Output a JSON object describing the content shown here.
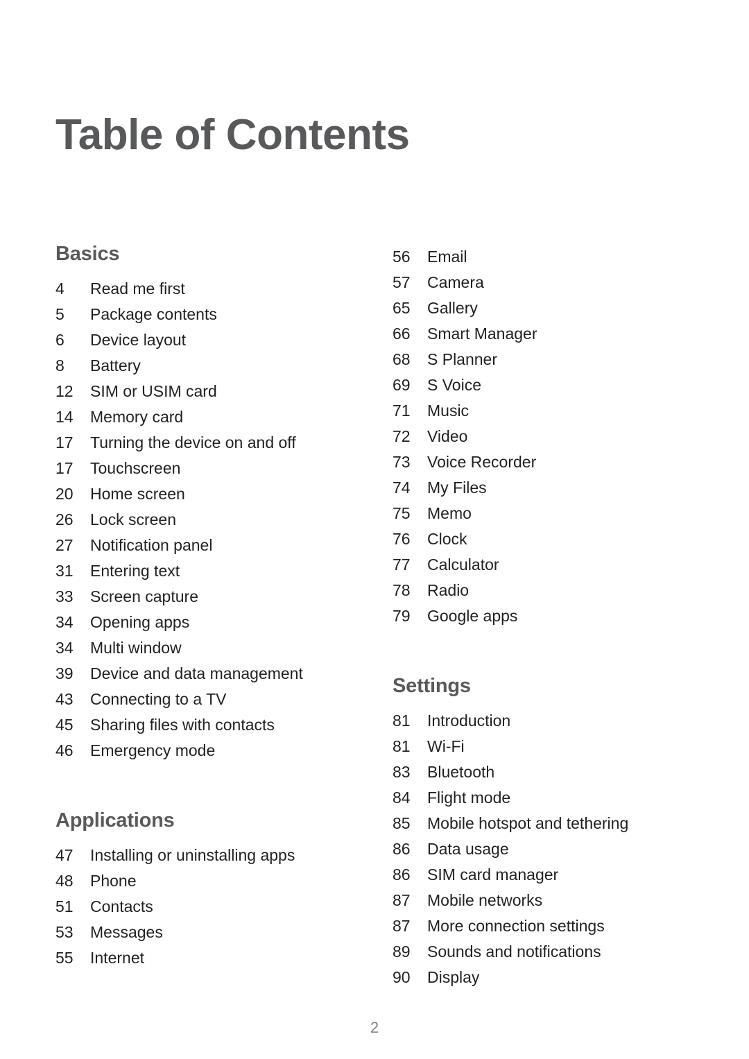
{
  "document": {
    "title": "Table of Contents",
    "page_number": "2",
    "colors": {
      "heading": "#58595b",
      "body_text": "#231f20",
      "page_number": "#808285",
      "background": "#ffffff"
    }
  },
  "columns": [
    {
      "name": "left-column",
      "sections": [
        {
          "heading": "Basics",
          "entries": [
            {
              "page": "4",
              "label": "Read me first"
            },
            {
              "page": "5",
              "label": "Package contents"
            },
            {
              "page": "6",
              "label": "Device layout"
            },
            {
              "page": "8",
              "label": "Battery"
            },
            {
              "page": "12",
              "label": "SIM or USIM card"
            },
            {
              "page": "14",
              "label": "Memory card"
            },
            {
              "page": "17",
              "label": "Turning the device on and off"
            },
            {
              "page": "17",
              "label": "Touchscreen"
            },
            {
              "page": "20",
              "label": "Home screen"
            },
            {
              "page": "26",
              "label": "Lock screen"
            },
            {
              "page": "27",
              "label": "Notification panel"
            },
            {
              "page": "31",
              "label": "Entering text"
            },
            {
              "page": "33",
              "label": "Screen capture"
            },
            {
              "page": "34",
              "label": "Opening apps"
            },
            {
              "page": "34",
              "label": "Multi window"
            },
            {
              "page": "39",
              "label": "Device and data management"
            },
            {
              "page": "43",
              "label": "Connecting to a TV"
            },
            {
              "page": "45",
              "label": "Sharing files with contacts"
            },
            {
              "page": "46",
              "label": "Emergency mode"
            }
          ]
        },
        {
          "heading": "Applications",
          "entries": [
            {
              "page": "47",
              "label": "Installing or uninstalling apps"
            },
            {
              "page": "48",
              "label": "Phone"
            },
            {
              "page": "51",
              "label": "Contacts"
            },
            {
              "page": "53",
              "label": "Messages"
            },
            {
              "page": "55",
              "label": "Internet"
            }
          ]
        }
      ]
    },
    {
      "name": "right-column",
      "sections": [
        {
          "heading": "",
          "entries": [
            {
              "page": "56",
              "label": "Email"
            },
            {
              "page": "57",
              "label": "Camera"
            },
            {
              "page": "65",
              "label": "Gallery"
            },
            {
              "page": "66",
              "label": "Smart Manager"
            },
            {
              "page": "68",
              "label": "S Planner"
            },
            {
              "page": "69",
              "label": "S Voice"
            },
            {
              "page": "71",
              "label": "Music"
            },
            {
              "page": "72",
              "label": "Video"
            },
            {
              "page": "73",
              "label": "Voice Recorder"
            },
            {
              "page": "74",
              "label": "My Files"
            },
            {
              "page": "75",
              "label": "Memo"
            },
            {
              "page": "76",
              "label": "Clock"
            },
            {
              "page": "77",
              "label": "Calculator"
            },
            {
              "page": "78",
              "label": "Radio"
            },
            {
              "page": "79",
              "label": "Google apps"
            }
          ]
        },
        {
          "heading": "Settings",
          "entries": [
            {
              "page": "81",
              "label": "Introduction"
            },
            {
              "page": "81",
              "label": "Wi-Fi"
            },
            {
              "page": "83",
              "label": "Bluetooth"
            },
            {
              "page": "84",
              "label": "Flight mode"
            },
            {
              "page": "85",
              "label": "Mobile hotspot and tethering"
            },
            {
              "page": "86",
              "label": "Data usage"
            },
            {
              "page": "86",
              "label": "SIM card manager"
            },
            {
              "page": "87",
              "label": "Mobile networks"
            },
            {
              "page": "87",
              "label": "More connection settings"
            },
            {
              "page": "89",
              "label": "Sounds and notifications"
            },
            {
              "page": "90",
              "label": "Display"
            }
          ]
        }
      ]
    }
  ]
}
